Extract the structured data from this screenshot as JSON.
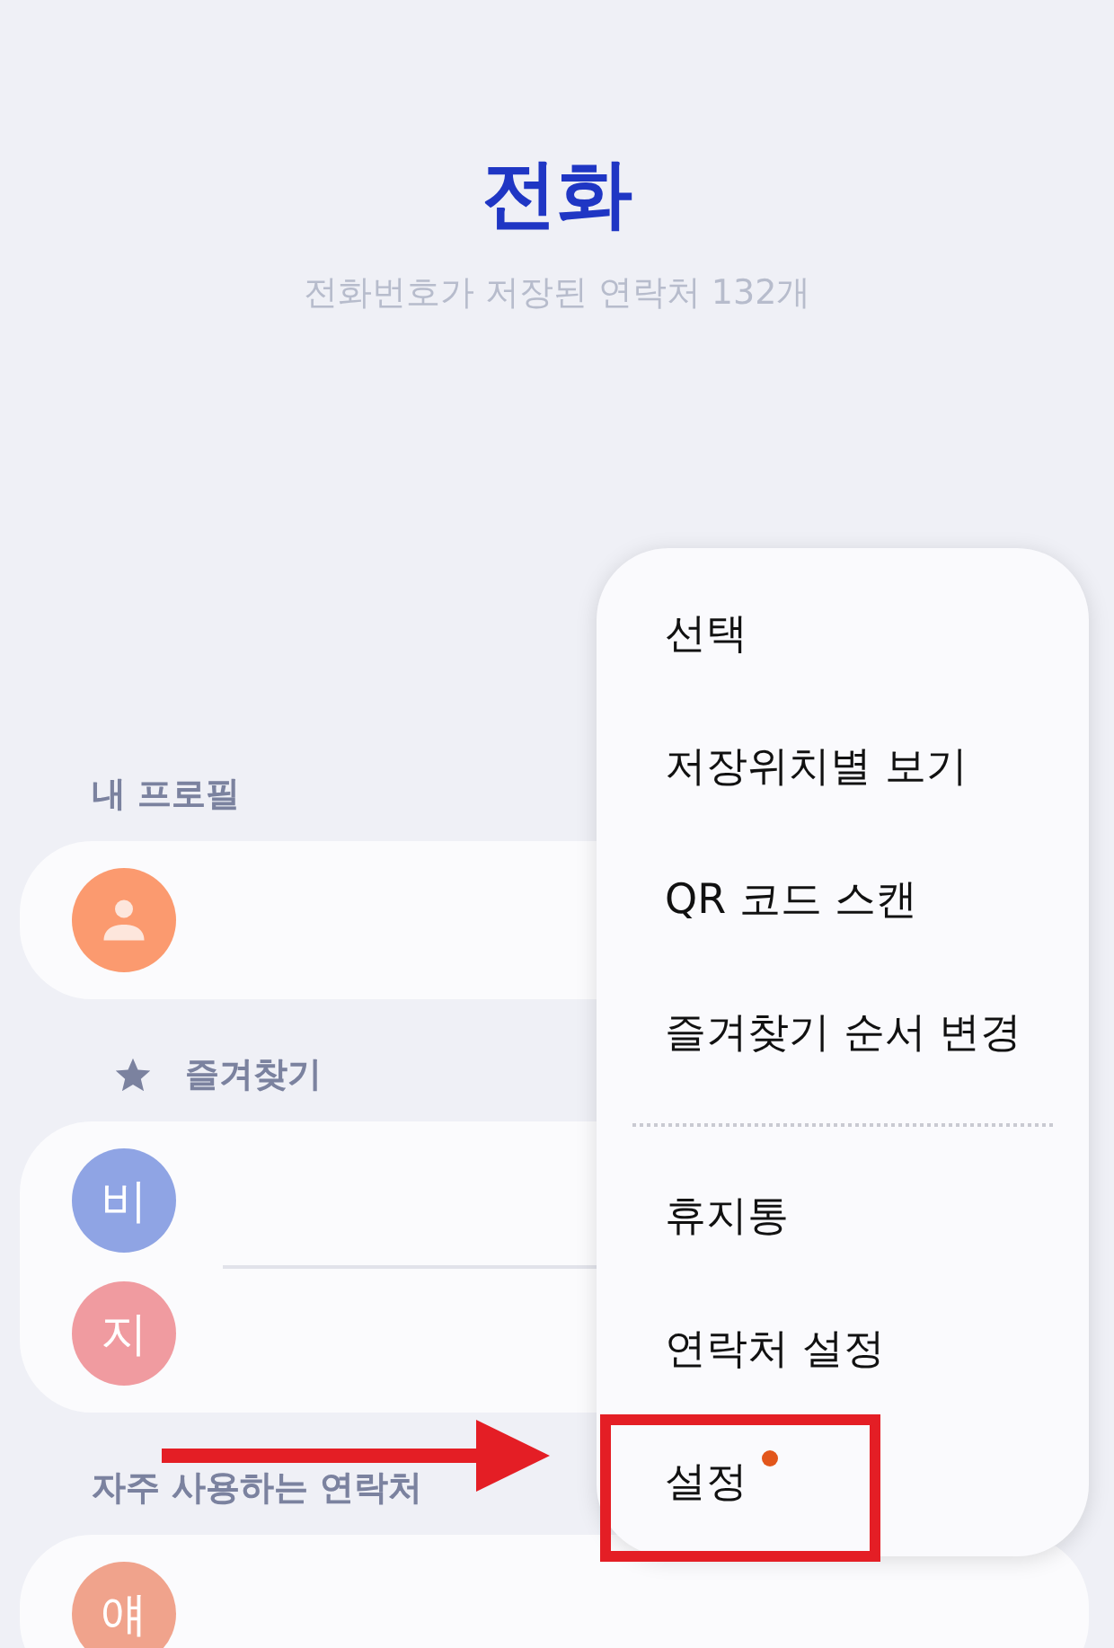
{
  "header": {
    "title": "전화",
    "subtitle": "전화번호가 저장된 연락처 132개"
  },
  "sections": [
    {
      "label": "내 프로필",
      "star": false,
      "contacts": [
        {
          "kind": "person",
          "color": "#fb9a6f"
        }
      ]
    },
    {
      "label": "즐겨찾기",
      "star": true,
      "contacts": [
        {
          "kind": "letter",
          "initial": "비",
          "color": "#8fa4e4"
        },
        {
          "kind": "letter",
          "initial": "지",
          "color": "#f09ba0"
        }
      ]
    },
    {
      "label": "자주 사용하는 연락처",
      "star": false,
      "contacts": [
        {
          "kind": "letter",
          "initial": "얘",
          "color": "#f0a38c"
        }
      ]
    }
  ],
  "menu": {
    "groups": [
      [
        {
          "label": "선택",
          "new_dot": false,
          "highlighted": false
        },
        {
          "label": "저장위치별 보기",
          "new_dot": false,
          "highlighted": false
        },
        {
          "label": "QR 코드 스캔",
          "new_dot": false,
          "highlighted": false
        },
        {
          "label": "즐겨찾기 순서 변경",
          "new_dot": false,
          "highlighted": false
        }
      ],
      [
        {
          "label": "휴지통",
          "new_dot": false,
          "highlighted": false
        },
        {
          "label": "연락처 설정",
          "new_dot": false,
          "highlighted": false
        },
        {
          "label": "설정",
          "new_dot": true,
          "highlighted": true
        }
      ]
    ]
  },
  "pointer_arrow": true
}
